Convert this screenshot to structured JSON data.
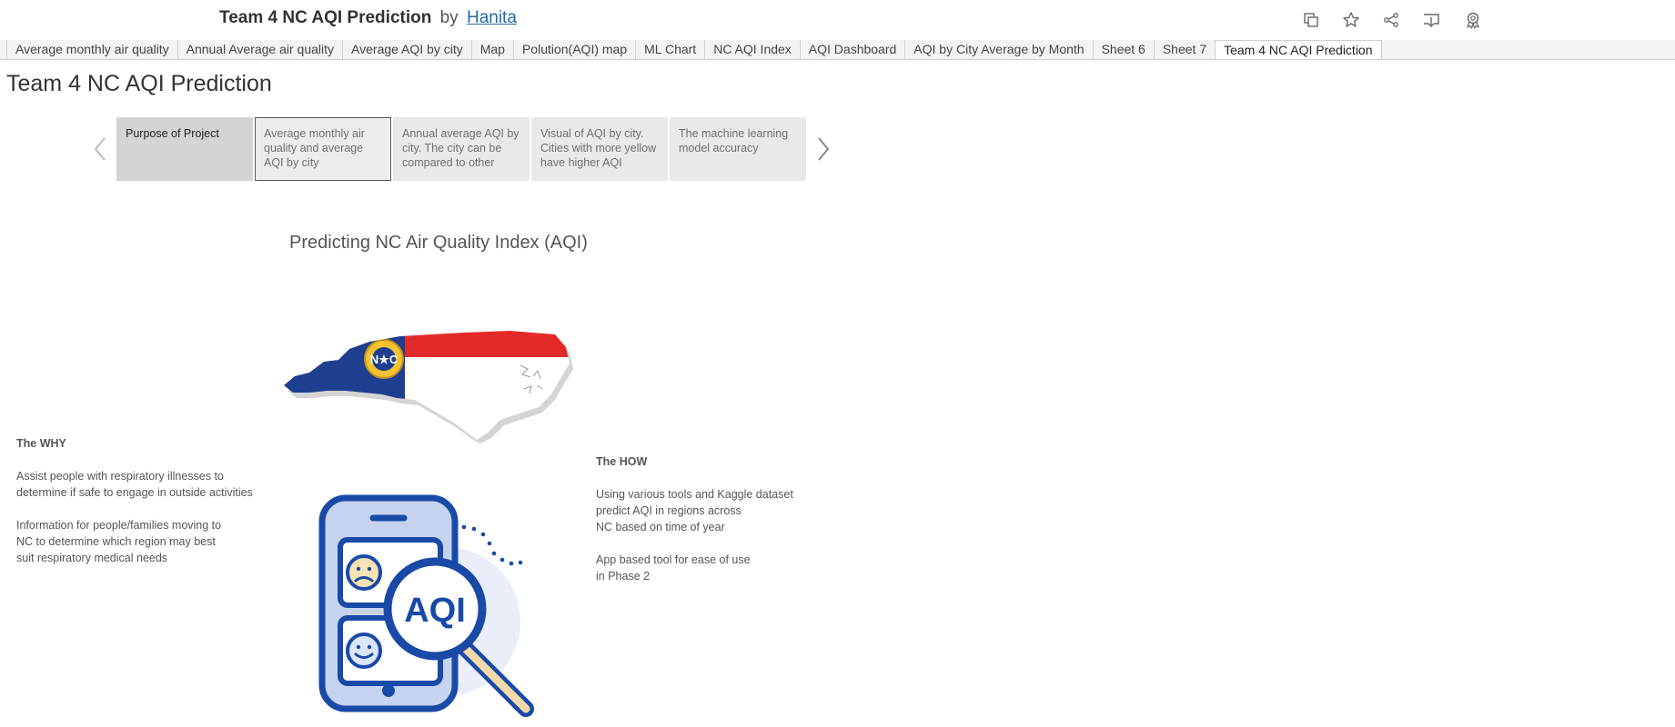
{
  "header": {
    "viz_title": "Team 4 NC AQI Prediction",
    "by": "by",
    "author": "Hanita",
    "icons": [
      "duplicate-icon",
      "favorite-star-icon",
      "share-icon",
      "download-icon",
      "badge-icon"
    ]
  },
  "tabs": [
    {
      "label": "Average monthly air quality"
    },
    {
      "label": "Annual Average air quality"
    },
    {
      "label": "Average AQI by city"
    },
    {
      "label": "Map"
    },
    {
      "label": "Polution(AQI) map"
    },
    {
      "label": "ML Chart"
    },
    {
      "label": "NC AQI Index"
    },
    {
      "label": "AQI Dashboard"
    },
    {
      "label": "AQI by City Average by Month"
    },
    {
      "label": "Sheet 6"
    },
    {
      "label": "Sheet 7"
    },
    {
      "label": "Team 4 NC AQI Prediction",
      "active": true
    }
  ],
  "story": {
    "title": "Team 4 NC AQI Prediction",
    "points": [
      {
        "text": "Purpose of Project"
      },
      {
        "text": "Average monthly air quality and average AQI by city"
      },
      {
        "text": "Annual average AQI by city.  The city can be compared to other"
      },
      {
        "text": "Visual of AQI by city. Cities with more yellow have higher AQI"
      },
      {
        "text": "The machine learning model accuracy"
      }
    ]
  },
  "dashboard": {
    "title": "Predicting NC Air Quality Index (AQI)",
    "flag_seal": "N★C",
    "illustration_label": "AQI",
    "why": {
      "heading": "The WHY",
      "lines": [
        "Assist people with respiratory illnesses to",
        "determine if safe to engage in outside activities",
        "",
        "Information for people/families moving to",
        "NC to determine which region may best",
        "suit respiratory medical needs"
      ]
    },
    "how": {
      "heading": "The HOW",
      "lines": [
        "Using various tools and Kaggle dataset",
        "predict AQI in regions across",
        "NC based on time of year",
        "",
        "App based tool for ease of use",
        "in Phase 2"
      ]
    }
  },
  "colors": {
    "flag_blue": "#1e3f8f",
    "flag_red": "#e32a2a",
    "illustration_blue": "#1a4aa8",
    "link": "#1f6aa8"
  }
}
